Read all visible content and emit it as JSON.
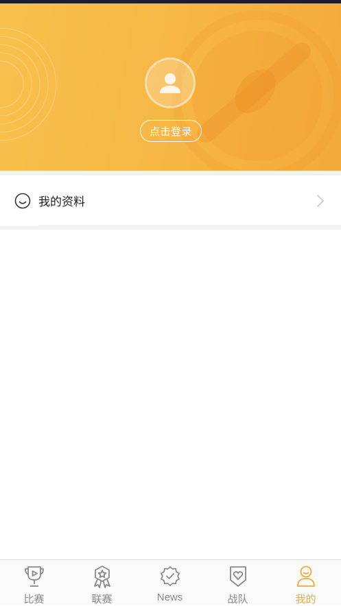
{
  "header": {
    "login_label": "点击登录"
  },
  "menu": {
    "items": [
      {
        "label": "我的资料",
        "icon": "smile-icon"
      }
    ]
  },
  "tabbar": {
    "active_color": "#f0a93a",
    "inactive_color": "#8a8a8a",
    "tabs": [
      {
        "label": "比赛",
        "icon": "trophy-icon",
        "active": false
      },
      {
        "label": "联赛",
        "icon": "medal-icon",
        "active": false
      },
      {
        "label": "News",
        "icon": "badge-check-icon",
        "active": false
      },
      {
        "label": "战队",
        "icon": "shield-heart-icon",
        "active": false
      },
      {
        "label": "我的",
        "icon": "user-icon",
        "active": true
      }
    ]
  },
  "colors": {
    "header_gradient_start": "#f7c04c",
    "header_gradient_end": "#f3a93c"
  }
}
